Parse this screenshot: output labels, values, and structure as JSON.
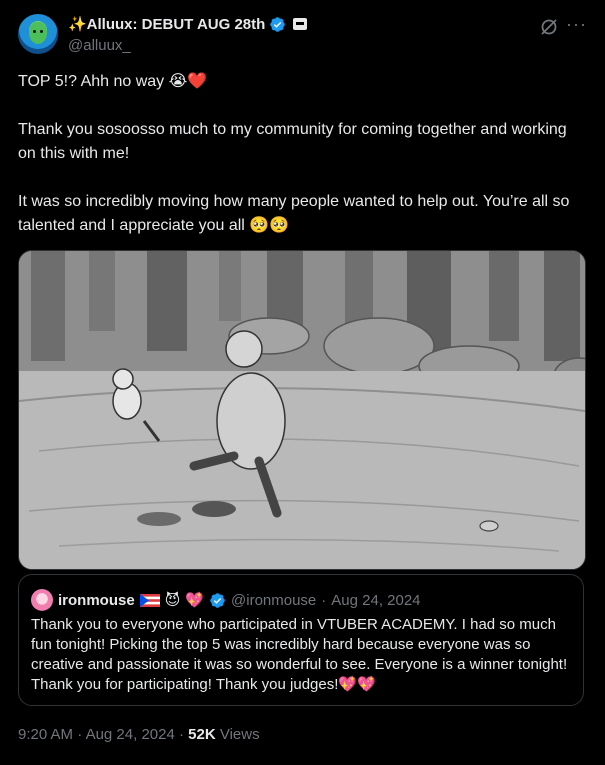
{
  "author": {
    "display_name": "✨Alluux: DEBUT AUG 28th",
    "handle": "@alluux_"
  },
  "tweet": {
    "paragraphs": [
      "TOP 5!? Ahh no way 😭❤️",
      "Thank you sosoosso much to my community for coming together and working on this with me!",
      "It was so incredibly moving how many people wanted to help out. You’re all so talented and I appreciate you all 🥺🥺"
    ]
  },
  "quote": {
    "name": "ironmouse",
    "handle": "@ironmouse",
    "separator": "·",
    "date": "Aug 24, 2024",
    "text": "Thank you to everyone who participated in VTUBER ACADEMY. I had so much fun tonight! Picking the top 5 was incredibly hard because everyone was so creative and passionate it was so wonderful to see. Everyone is a winner tonight! Thank you for participating! Thank you judges!💖💖"
  },
  "meta": {
    "time": "9:20 AM",
    "dot1": "·",
    "date": "Aug 24, 2024",
    "dot2": "·",
    "views_count": "52K",
    "views_label": "Views"
  },
  "colors": {
    "background": "#000000",
    "text": "#e7e9ea",
    "secondary": "#71767b",
    "border": "#2f3336",
    "verified": "#1d9bf0"
  },
  "icons": [
    "verified-badge-icon",
    "label-badge-icon",
    "grok-icon",
    "more-icon",
    "puerto-rico-flag-icon"
  ]
}
